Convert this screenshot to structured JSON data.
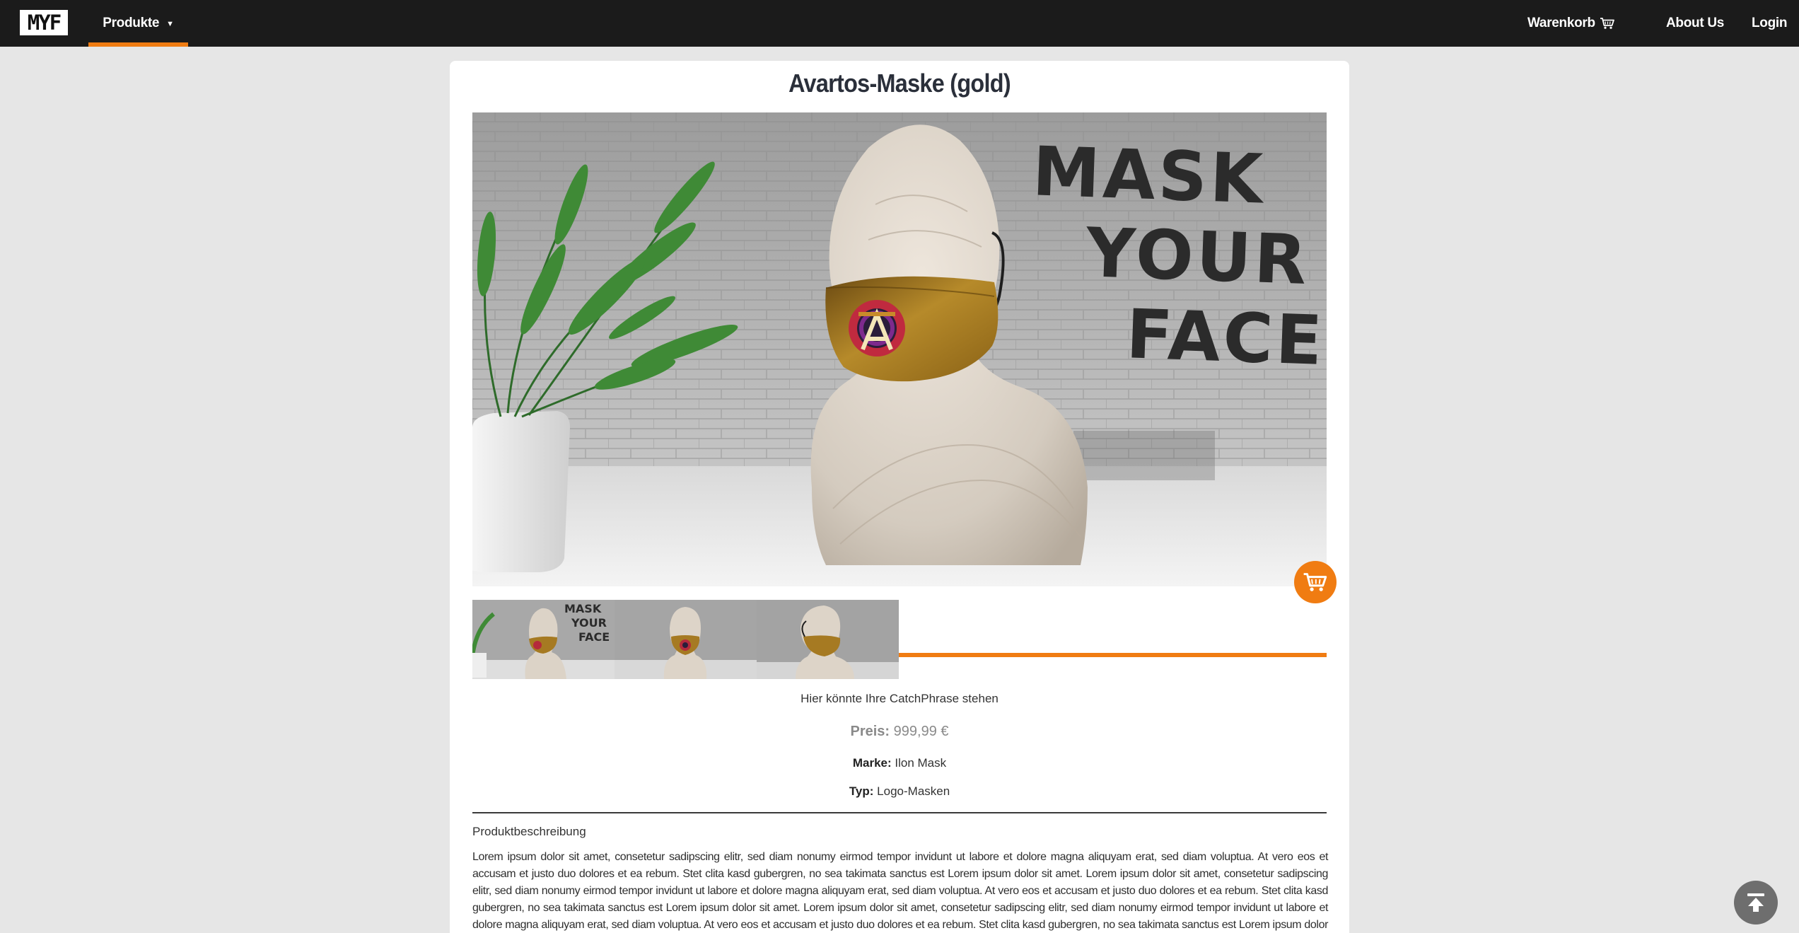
{
  "brand": {
    "logo_text": "MYF"
  },
  "nav": {
    "produkte_label": "Produkte",
    "cart_label": "Warenkorb",
    "about_label": "About Us",
    "login_label": "Login"
  },
  "product": {
    "title": "Avartos-Maske (gold)",
    "catchphrase": "Hier könnte Ihre CatchPhrase stehen",
    "price_label": "Preis:",
    "price_value": "999,99 €",
    "brand_label": "Marke:",
    "brand_value": "Ilon Mask",
    "type_label": "Typ:",
    "type_value": "Logo-Masken",
    "description_heading": "Produktbeschreibung",
    "description": "Lorem ipsum dolor sit amet, consetetur sadipscing elitr, sed diam nonumy eirmod tempor invidunt ut labore et dolore magna aliquyam erat, sed diam voluptua. At vero eos et accusam et justo duo dolores et ea rebum. Stet clita kasd gubergren, no sea takimata sanctus est Lorem ipsum dolor sit amet. Lorem ipsum dolor sit amet, consetetur sadipscing elitr, sed diam nonumy eirmod tempor invidunt ut labore et dolore magna aliquyam erat, sed diam voluptua. At vero eos et accusam et justo duo dolores et ea rebum. Stet clita kasd gubergren, no sea takimata sanctus est Lorem ipsum dolor sit amet. Lorem ipsum dolor sit amet, consetetur sadipscing elitr, sed diam nonumy eirmod tempor invidunt ut labore et dolore magna aliquyam erat, sed diam voluptua. At vero eos et accusam et justo duo dolores et ea rebum. Stet clita kasd gubergren, no sea takimata sanctus est Lorem ipsum dolor sit amet."
  },
  "image": {
    "wall_text": [
      "MASK",
      "YOUR",
      "FACE"
    ]
  },
  "colors": {
    "accent": "#f07c12",
    "navbar": "#1b1b1b",
    "page_bg": "#e6e6e6",
    "mask_gold": "#a8781c"
  },
  "icons": {
    "cart": "cart-icon",
    "dropdown": "caret-down-icon",
    "scroll_top": "arrow-up-to-top-icon"
  }
}
